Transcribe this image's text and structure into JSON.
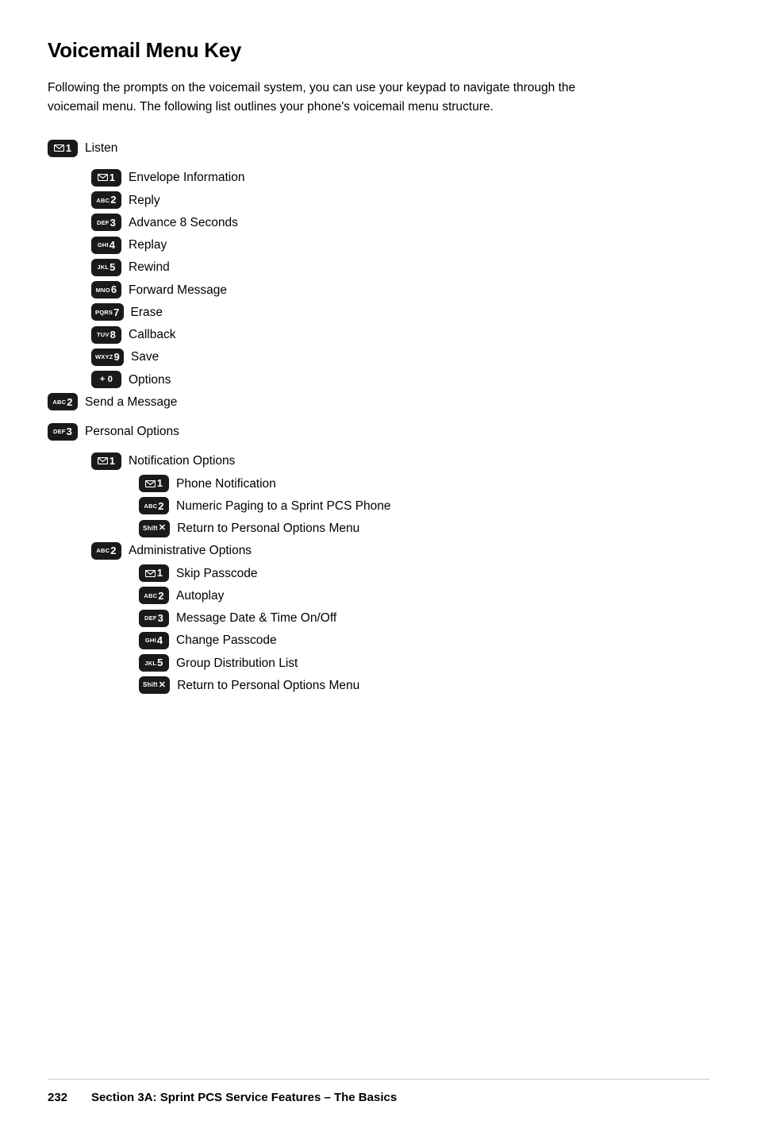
{
  "page": {
    "title": "Voicemail Menu Key",
    "intro": "Following the prompts on the voicemail system, you can use your keypad to navigate through the voicemail menu. The following list outlines your phone's voicemail menu structure.",
    "footer": {
      "page": "232",
      "text": "Section 3A: Sprint PCS Service Features – The Basics"
    }
  },
  "menu": [
    {
      "badge_top": "✉",
      "badge_num": "1",
      "badge_sub": "",
      "label": "Listen",
      "level": 0,
      "children": [
        {
          "badge_top": "✉",
          "badge_num": "1",
          "badge_sub": "",
          "label": "Envelope Information",
          "level": 1
        },
        {
          "badge_top": "ABC",
          "badge_num": "2",
          "badge_sub": "",
          "label": "Reply",
          "level": 1
        },
        {
          "badge_top": "DEF",
          "badge_num": "3",
          "badge_sub": "",
          "label": "Advance 8 Seconds",
          "level": 1
        },
        {
          "badge_top": "GHI",
          "badge_num": "4",
          "badge_sub": "",
          "label": "Replay",
          "level": 1
        },
        {
          "badge_top": "JKL",
          "badge_num": "5",
          "badge_sub": "",
          "label": "Rewind",
          "level": 1
        },
        {
          "badge_top": "MNO",
          "badge_num": "6",
          "badge_sub": "",
          "label": "Forward Message",
          "level": 1
        },
        {
          "badge_top": "PQRS",
          "badge_num": "7",
          "badge_sub": "",
          "label": "Erase",
          "level": 1
        },
        {
          "badge_top": "TUV",
          "badge_num": "8",
          "badge_sub": "",
          "label": "Callback",
          "level": 1
        },
        {
          "badge_top": "WXYZ",
          "badge_num": "9",
          "badge_sub": "",
          "label": "Save",
          "level": 1
        },
        {
          "badge_top": "+",
          "badge_num": "0",
          "badge_sub": "",
          "label": "Options",
          "level": 1
        }
      ]
    },
    {
      "badge_top": "ABC",
      "badge_num": "2",
      "badge_sub": "",
      "label": "Send a Message",
      "level": 0,
      "children": []
    },
    {
      "badge_top": "DEF",
      "badge_num": "3",
      "badge_sub": "",
      "label": "Personal Options",
      "level": 0,
      "children": [
        {
          "badge_top": "✉",
          "badge_num": "1",
          "badge_sub": "",
          "label": "Notification Options",
          "level": 1,
          "children": [
            {
              "badge_top": "✉",
              "badge_num": "1",
              "badge_sub": "",
              "label": "Phone Notification",
              "level": 2
            },
            {
              "badge_top": "ABC",
              "badge_num": "2",
              "badge_sub": "",
              "label": "Numeric Paging to a Sprint PCS Phone",
              "level": 2
            },
            {
              "badge_top": "Shift",
              "badge_num": "✕",
              "badge_sub": "",
              "label": "Return to Personal Options Menu",
              "level": 2
            }
          ]
        },
        {
          "badge_top": "ABC",
          "badge_num": "2",
          "badge_sub": "",
          "label": "Administrative Options",
          "level": 1,
          "children": [
            {
              "badge_top": "✉",
              "badge_num": "1",
              "badge_sub": "",
              "label": "Skip Passcode",
              "level": 2
            },
            {
              "badge_top": "ABC",
              "badge_num": "2",
              "badge_sub": "",
              "label": "Autoplay",
              "level": 2
            },
            {
              "badge_top": "DEF",
              "badge_num": "3",
              "badge_sub": "",
              "label": "Message Date & Time On/Off",
              "level": 2
            },
            {
              "badge_top": "GHI",
              "badge_num": "4",
              "badge_sub": "",
              "label": "Change Passcode",
              "level": 2
            },
            {
              "badge_top": "JKL",
              "badge_num": "5",
              "badge_sub": "",
              "label": "Group Distribution List",
              "level": 2
            },
            {
              "badge_top": "Shift",
              "badge_num": "✕",
              "badge_sub": "",
              "label": "Return to Personal Options Menu",
              "level": 2
            }
          ]
        }
      ]
    }
  ]
}
